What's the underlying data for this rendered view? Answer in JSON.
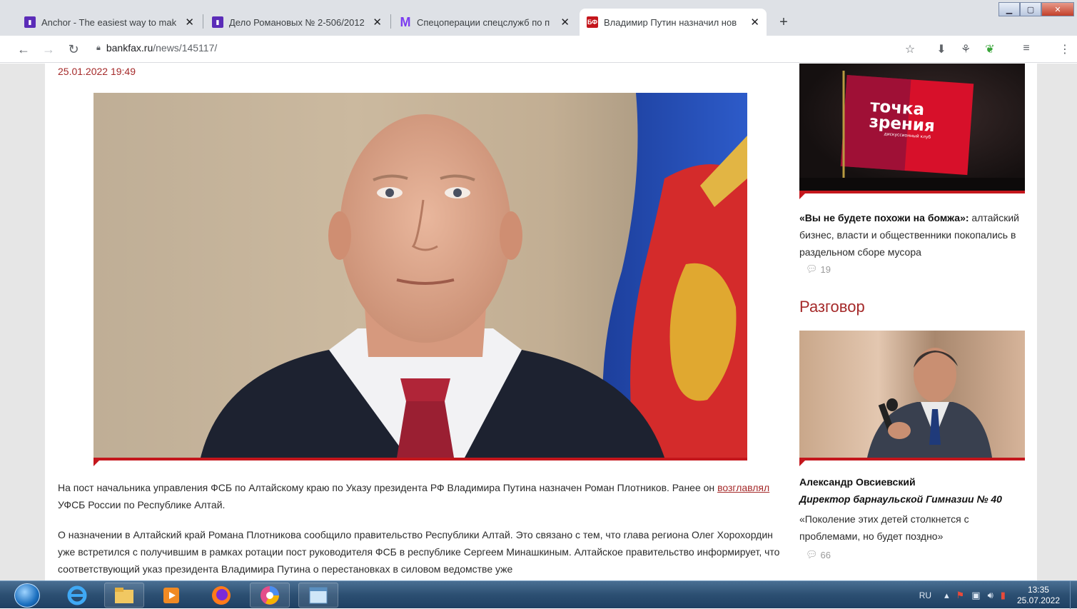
{
  "browser": {
    "tabs": [
      {
        "title": "Anchor - The easiest way to mak",
        "favicon": "anchor-icon",
        "color": "#5b2cb8"
      },
      {
        "title": "Дело Романовых № 2-506/2012",
        "favicon": "anchor-icon",
        "color": "#5b2cb8"
      },
      {
        "title": "Спецоперации спецслужб по п",
        "favicon": "m-icon",
        "color": "#7b3cf0"
      },
      {
        "title": "Владимир Путин назначил нов",
        "favicon": "bankfax-icon",
        "color": "#c4161c"
      }
    ],
    "new_tab_label": "+",
    "url_host": "bankfax.ru",
    "url_path": "/news/145117/"
  },
  "article": {
    "date": "25.01.2022 19:49",
    "para1_before": "На пост начальника управления ФСБ по Алтайскому краю по Указу президента РФ Владимира Путина назначен Роман Плотников. Ранее он ",
    "para1_link": "возглавлял",
    "para1_after": " УФСБ России по Республике Алтай.",
    "para2": "О назначении в Алтайский край Романа Плотникова сообщило правительство Республики Алтай. Это связано с тем, что глава региона Олег Хорохордин уже встретился с получившим в рамках ротации пост руководителя ФСБ в республике Сергеем Минашкиным. Алтайское правительство информирует, что соответствующий указ президента Владимира Путина о перестановках в силовом ведомстве уже"
  },
  "sidebar": {
    "promo_line1": "точка",
    "promo_line2": "зрения",
    "promo_sub": "дискуссионный клуб",
    "news_title_bold": "«Вы не будете похожи на бомжа»:",
    "news_title_rest": " алтайский бизнес, власти и общественники покопались в раздельном сборе мусора",
    "news_comments": "19",
    "section_heading": "Разговор",
    "person_name": "Александр Овсиевский",
    "person_role": "Директор барнаульской Гимназии № 40",
    "person_quote": "«Поколение этих детей столкнется с проблемами, но будет поздно»",
    "person_comments": "66"
  },
  "taskbar": {
    "lang": "RU",
    "time": "13:35",
    "date": "25.07.2022"
  },
  "colors": {
    "accent_red": "#c4161c",
    "date_red": "#a52a2a"
  }
}
